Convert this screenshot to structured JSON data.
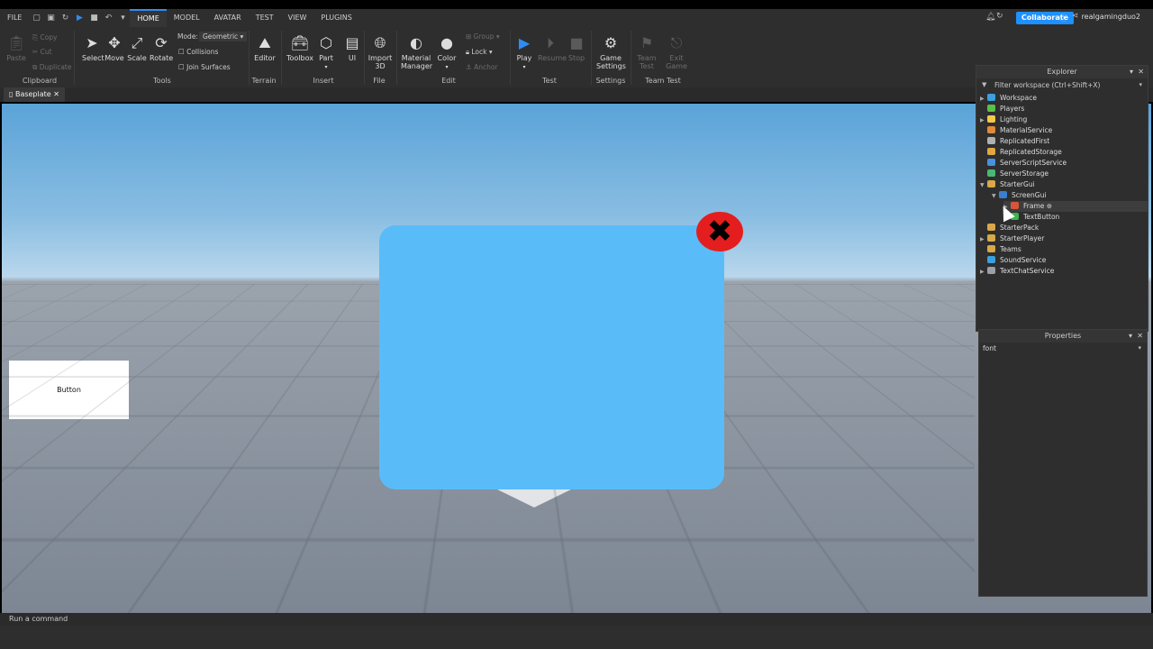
{
  "menubar": {
    "file": "FILE",
    "tabs": [
      "HOME",
      "MODEL",
      "AVATAR",
      "TEST",
      "VIEW",
      "PLUGINS"
    ],
    "active_tab": "HOME",
    "collaborate": "Collaborate",
    "username": "realgamingduo2"
  },
  "ribbon": {
    "clipboard": {
      "paste": "Paste",
      "copy": "Copy",
      "cut": "Cut",
      "duplicate": "Duplicate",
      "group": "Clipboard"
    },
    "tools": {
      "select": "Select",
      "move": "Move",
      "scale": "Scale",
      "rotate": "Rotate",
      "mode_label": "Mode:",
      "mode_value": "Geometric",
      "collisions": "Collisions",
      "join_surfaces": "Join Surfaces",
      "group": "Tools"
    },
    "terrain": {
      "editor": "Editor",
      "group": "Terrain"
    },
    "insert": {
      "toolbox": "Toolbox",
      "part": "Part",
      "ui": "UI",
      "group": "Insert"
    },
    "file": {
      "import3d_line1": "Import",
      "import3d_line2": "3D",
      "group": "File"
    },
    "edit": {
      "material_line1": "Material",
      "material_line2": "Manager",
      "color": "Color",
      "group_btn": "Group",
      "lock": "Lock",
      "anchor": "Anchor",
      "group": "Edit"
    },
    "test": {
      "play": "Play",
      "resume": "Resume",
      "stop": "Stop",
      "group": "Test"
    },
    "settings": {
      "game_line1": "Game",
      "game_line2": "Settings",
      "group": "Settings"
    },
    "team_test": {
      "team_line1": "Team",
      "team_line2": "Test",
      "exit_line1": "Exit",
      "exit_line2": "Game",
      "group": "Team Test"
    }
  },
  "document_tab": {
    "label": "Baseplate"
  },
  "viewport": {
    "text_button_label": "Button",
    "frame_color": "#59bcf8",
    "close_color": "#e41e1e"
  },
  "explorer": {
    "title": "Explorer",
    "filter_placeholder": "Filter workspace (Ctrl+Shift+X)",
    "items": [
      {
        "label": "Workspace",
        "color": "#3aa0e0"
      },
      {
        "label": "Players",
        "color": "#5bbf4a"
      },
      {
        "label": "Lighting",
        "color": "#f2c94c"
      },
      {
        "label": "MaterialService",
        "color": "#e08a3a"
      },
      {
        "label": "ReplicatedFirst",
        "color": "#b0b0b0"
      },
      {
        "label": "ReplicatedStorage",
        "color": "#e0a640"
      },
      {
        "label": "ServerScriptService",
        "color": "#4a8fe0"
      },
      {
        "label": "ServerStorage",
        "color": "#48b874"
      },
      {
        "label": "StarterGui",
        "color": "#d9a848"
      },
      {
        "label": "ScreenGui",
        "color": "#3a7fd0"
      },
      {
        "label": "Frame",
        "color": "#d9553a"
      },
      {
        "label": "TextButton",
        "color": "#3fb34f"
      },
      {
        "label": "StarterPack",
        "color": "#d9a848"
      },
      {
        "label": "StarterPlayer",
        "color": "#d9a848"
      },
      {
        "label": "Teams",
        "color": "#d9a848"
      },
      {
        "label": "SoundService",
        "color": "#3aa0e0"
      },
      {
        "label": "TextChatService",
        "color": "#9aa0a8"
      }
    ]
  },
  "properties": {
    "title": "Properties",
    "filter_value": "font"
  },
  "command_bar": {
    "placeholder": "Run a command"
  }
}
